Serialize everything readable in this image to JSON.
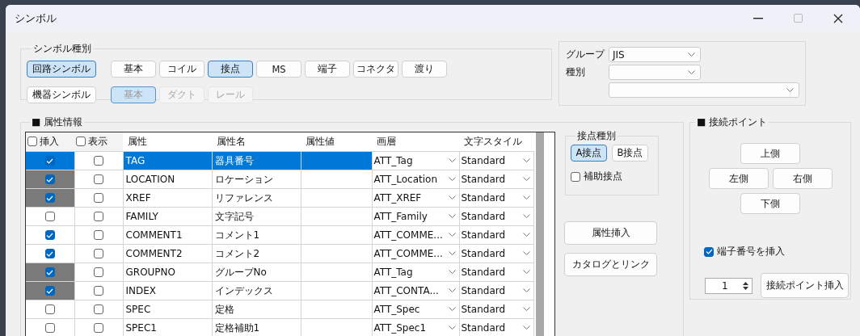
{
  "window": {
    "title": "シンボル"
  },
  "symbol_type": {
    "title": "シンボル種別",
    "rows": [
      {
        "category": {
          "label": "回路シンボル",
          "selected": true
        },
        "items": [
          {
            "label": "基本",
            "selected": false,
            "disabled": false
          },
          {
            "label": "コイル",
            "selected": false,
            "disabled": false
          },
          {
            "label": "接点",
            "selected": true,
            "disabled": false
          },
          {
            "label": "MS",
            "selected": false,
            "disabled": false
          },
          {
            "label": "端子",
            "selected": false,
            "disabled": false
          },
          {
            "label": "コネクタ",
            "selected": false,
            "disabled": false
          },
          {
            "label": "渡り",
            "selected": false,
            "disabled": false
          }
        ]
      },
      {
        "category": {
          "label": "機器シンボル",
          "selected": false
        },
        "items": [
          {
            "label": "基本",
            "selected": true,
            "disabled": true
          },
          {
            "label": "ダクト",
            "selected": false,
            "disabled": true
          },
          {
            "label": "レール",
            "selected": false,
            "disabled": true
          }
        ]
      }
    ]
  },
  "filter": {
    "group_label": "グループ",
    "group_value": "JIS",
    "type_label": "種別"
  },
  "attributes": {
    "title": "■ 属性情報",
    "columns": [
      {
        "label": "挿入",
        "kind": "check",
        "checked": false
      },
      {
        "label": "表示",
        "kind": "check",
        "checked": false
      },
      {
        "label": "属性",
        "kind": "text"
      },
      {
        "label": "属性名",
        "kind": "text"
      },
      {
        "label": "属性値",
        "kind": "text"
      },
      {
        "label": "画層",
        "kind": "combo"
      },
      {
        "label": "文字スタイル",
        "kind": "combo"
      }
    ],
    "rows": [
      {
        "selected": true,
        "insert": true,
        "shaded": false,
        "display": false,
        "attribute": "TAG",
        "name": "器具番号",
        "layer": "ATT_Tag",
        "style": "Standard"
      },
      {
        "selected": false,
        "insert": true,
        "shaded": true,
        "display": false,
        "attribute": "LOCATION",
        "name": "ロケーション",
        "layer": "ATT_Location",
        "style": "Standard"
      },
      {
        "selected": false,
        "insert": true,
        "shaded": true,
        "display": false,
        "attribute": "XREF",
        "name": "リファレンス",
        "layer": "ATT_XREF",
        "style": "Standard"
      },
      {
        "selected": false,
        "insert": false,
        "shaded": false,
        "display": false,
        "attribute": "FAMILY",
        "name": "文字記号",
        "layer": "ATT_Family",
        "style": "Standard"
      },
      {
        "selected": false,
        "insert": true,
        "shaded": false,
        "display": false,
        "attribute": "COMMENT1",
        "name": "コメント1",
        "layer": "ATT_COMME...",
        "style": "Standard"
      },
      {
        "selected": false,
        "insert": true,
        "shaded": false,
        "display": false,
        "attribute": "COMMENT2",
        "name": "コメント2",
        "layer": "ATT_COMME...",
        "style": "Standard"
      },
      {
        "selected": false,
        "insert": true,
        "shaded": true,
        "display": false,
        "attribute": "GROUPNO",
        "name": "グループNo",
        "layer": "ATT_Tag",
        "style": "Standard"
      },
      {
        "selected": false,
        "insert": true,
        "shaded": true,
        "display": false,
        "attribute": "INDEX",
        "name": "インデックス",
        "layer": "ATT_CONTA...",
        "style": "Standard"
      },
      {
        "selected": false,
        "insert": false,
        "shaded": false,
        "display": false,
        "attribute": "SPEC",
        "name": "定格",
        "layer": "ATT_Spec",
        "style": "Standard"
      },
      {
        "selected": false,
        "insert": false,
        "shaded": false,
        "display": false,
        "attribute": "SPEC1",
        "name": "定格補助1",
        "layer": "ATT_Spec1",
        "style": "Standard"
      }
    ]
  },
  "contact_type": {
    "title": "接点種別",
    "options": [
      {
        "label": "A接点",
        "selected": true
      },
      {
        "label": "B接点",
        "selected": false
      }
    ],
    "auxiliary": {
      "label": "補助接点",
      "checked": false
    }
  },
  "actions": [
    "属性挿入",
    "カタログとリンク"
  ],
  "connection_points": {
    "title": "■ 接続ポイント",
    "top": "上側",
    "left": "左側",
    "right": "右側",
    "bottom": "下側",
    "terminal_number": {
      "label": "端子番号を挿入",
      "checked": true
    },
    "count": "1",
    "insert_button": "接続ポイント挿入"
  }
}
